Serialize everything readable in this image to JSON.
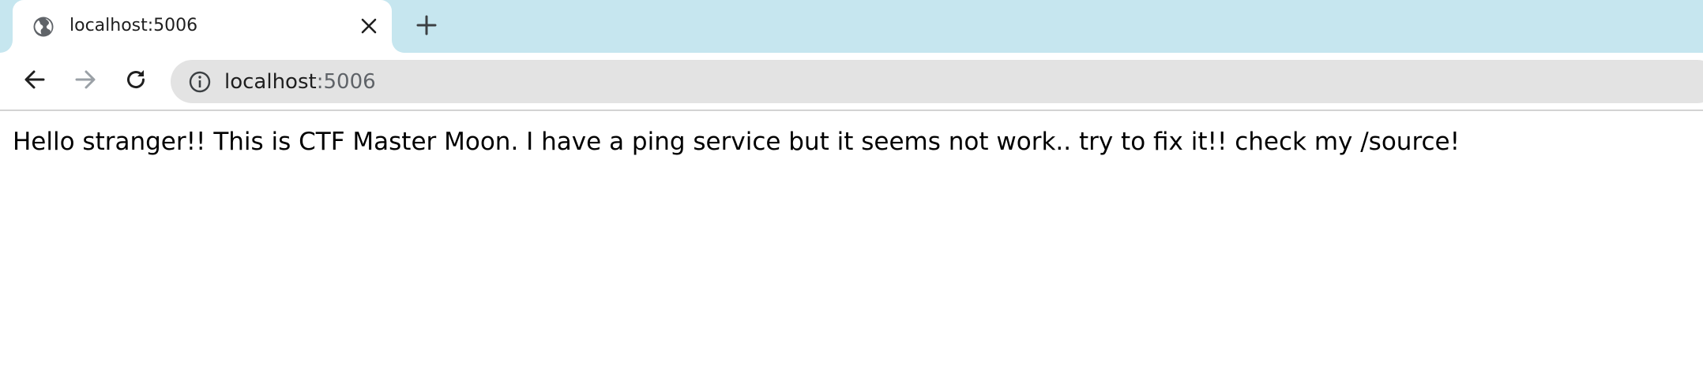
{
  "tab": {
    "title": "localhost:5006"
  },
  "address_bar": {
    "host": "localhost",
    "port": ":5006"
  },
  "page": {
    "message": "Hello stranger!! This is CTF Master Moon. I have a ping service but it seems not work.. try to fix it!! check my /source!"
  },
  "colors": {
    "tabstrip_background": "#c6e6ef",
    "omnibox_background": "#e3e3e3"
  }
}
